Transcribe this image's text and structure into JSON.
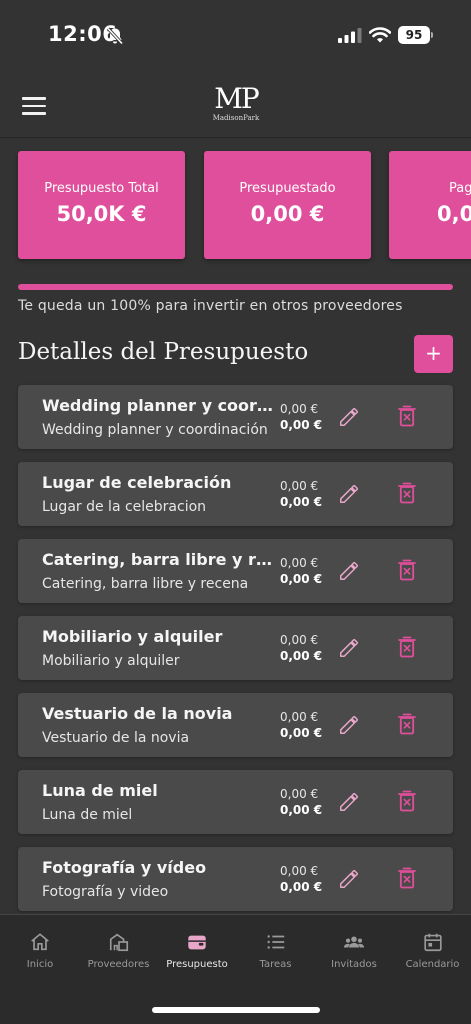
{
  "status_bar": {
    "time": "12:06",
    "battery": "95",
    "icons": [
      "bell-slash-icon",
      "signal-icon",
      "wifi-icon",
      "battery-icon"
    ]
  },
  "header": {
    "logo_mark": "MP",
    "logo_text": "MadisonPark",
    "menu_icon": "menu-icon"
  },
  "summary_cards": [
    {
      "label": "Presupuesto Total",
      "value": "50,0K €"
    },
    {
      "label": "Presupuestado",
      "value": "0,00 €"
    },
    {
      "label": "Pag",
      "value": "0,0"
    }
  ],
  "progress": {
    "fraction": 1.0,
    "caption": "Te queda un 100% para invertir en otros proveedores"
  },
  "section": {
    "title": "Detalles del Presupuesto",
    "add_label": "+"
  },
  "items": [
    {
      "title": "Wedding planner y coordinación",
      "subtitle": "Wedding planner y coordinación",
      "amount1": "0,00 €",
      "amount2": "0,00 €"
    },
    {
      "title": "Lugar de celebración",
      "subtitle": "Lugar de la celebracion",
      "amount1": "0,00 €",
      "amount2": "0,00 €"
    },
    {
      "title": "Catering, barra libre y recena",
      "subtitle": "Catering, barra libre y recena",
      "amount1": "0,00 €",
      "amount2": "0,00 €"
    },
    {
      "title": "Mobiliario y alquiler",
      "subtitle": "Mobiliario y alquiler",
      "amount1": "0,00 €",
      "amount2": "0,00 €"
    },
    {
      "title": "Vestuario de la novia",
      "subtitle": "Vestuario de la novia",
      "amount1": "0,00 €",
      "amount2": "0,00 €"
    },
    {
      "title": "Luna de miel",
      "subtitle": "Luna de miel",
      "amount1": "0,00 €",
      "amount2": "0,00 €"
    },
    {
      "title": "Fotografía y vídeo",
      "subtitle": "Fotografía y video",
      "amount1": "0,00 €",
      "amount2": "0,00 €"
    }
  ],
  "tabs": [
    {
      "label": "Inicio",
      "icon": "home-icon"
    },
    {
      "label": "Proveedores",
      "icon": "buildings-icon"
    },
    {
      "label": "Presupuesto",
      "icon": "wallet-icon",
      "active": true
    },
    {
      "label": "Tareas",
      "icon": "list-icon"
    },
    {
      "label": "Invitados",
      "icon": "people-icon"
    },
    {
      "label": "Calendario",
      "icon": "calendar-icon"
    }
  ],
  "colors": {
    "accent": "#e04f9b",
    "background": "#333333",
    "card": "#4a4a4a",
    "icon_pink": "#e8a6c8"
  }
}
